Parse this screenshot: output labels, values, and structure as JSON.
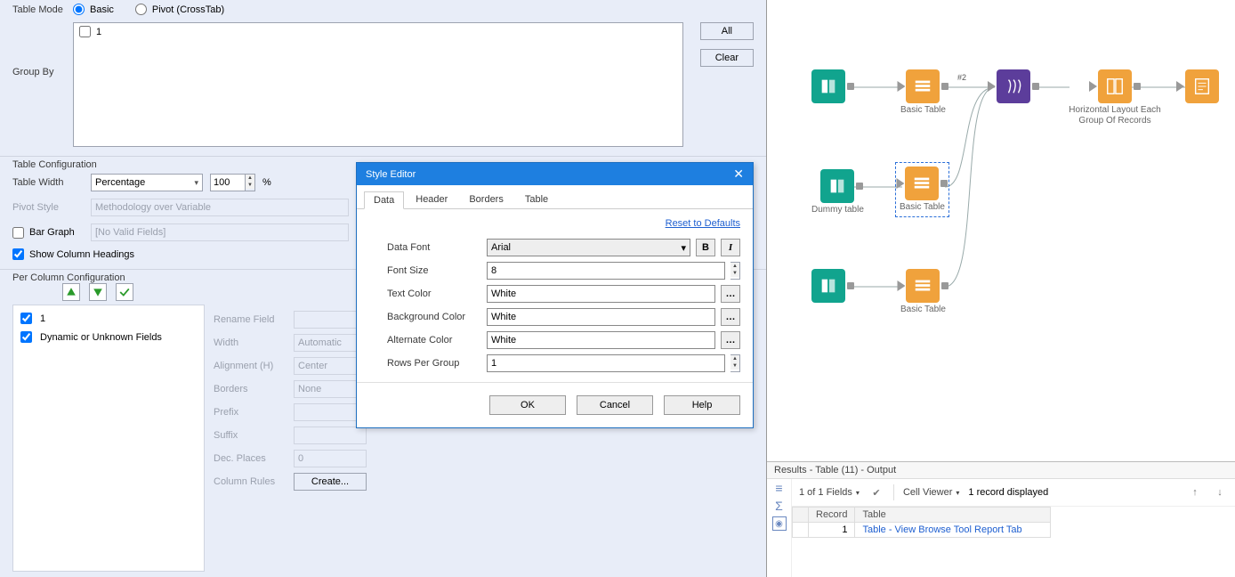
{
  "config": {
    "tableMode": {
      "label": "Table Mode",
      "basic": "Basic",
      "pivot": "Pivot (CrossTab)",
      "selected": "basic"
    },
    "groupBy": {
      "label": "Group By",
      "items": [
        "1"
      ],
      "allBtn": "All",
      "clearBtn": "Clear"
    },
    "tableConfig": {
      "title": "Table Configuration",
      "tableWidth": {
        "label": "Table Width",
        "unit": "Percentage",
        "value": "100",
        "suffix": "%"
      },
      "pivotStyle": {
        "label": "Pivot Style",
        "value": "Methodology over Variable"
      },
      "barGraph": {
        "label": "Bar Graph",
        "value": "[No Valid Fields]",
        "checked": false
      },
      "showHeadings": {
        "label": "Show Column Headings",
        "checked": true
      }
    },
    "perColumn": {
      "title": "Per Column Configuration",
      "fields": [
        {
          "name": "1",
          "checked": true
        },
        {
          "name": "Dynamic or Unknown Fields",
          "checked": true
        }
      ],
      "props": {
        "renameField": {
          "label": "Rename Field",
          "value": ""
        },
        "width": {
          "label": "Width",
          "value": "Automatic"
        },
        "alignment": {
          "label": "Alignment (H)",
          "value": "Center"
        },
        "borders": {
          "label": "Borders",
          "value": "None"
        },
        "prefix": {
          "label": "Prefix",
          "value": ""
        },
        "suffix": {
          "label": "Suffix",
          "value": ""
        },
        "decPlaces": {
          "label": "Dec. Places",
          "value": "0"
        },
        "columnRules": {
          "label": "Column Rules",
          "btn": "Create..."
        }
      }
    }
  },
  "dialog": {
    "title": "Style Editor",
    "tabs": [
      "Data",
      "Header",
      "Borders",
      "Table"
    ],
    "activeTab": 0,
    "resetLink": "Reset to Defaults",
    "fields": {
      "dataFont": {
        "label": "Data Font",
        "value": "Arial"
      },
      "fontSize": {
        "label": "Font Size",
        "value": "8"
      },
      "textColor": {
        "label": "Text Color",
        "value": "White"
      },
      "bgColor": {
        "label": "Background Color",
        "value": "White"
      },
      "altColor": {
        "label": "Alternate Color",
        "value": "White"
      },
      "rowsPerGroup": {
        "label": "Rows Per Group",
        "value": "1"
      }
    },
    "buttons": {
      "ok": "OK",
      "cancel": "Cancel",
      "help": "Help"
    }
  },
  "canvas": {
    "nodes": {
      "n1": {
        "caption": ""
      },
      "n2": {
        "caption": "Basic Table"
      },
      "n3": {
        "caption": ""
      },
      "n4": {
        "caption": "Horizontal Layout Each Group Of Records"
      },
      "n5": {
        "caption": ""
      },
      "n6": {
        "caption": "Dummy table"
      },
      "n7": {
        "caption": "Basic Table"
      },
      "n8": {
        "caption": ""
      },
      "n9": {
        "caption": "Basic Table"
      },
      "anchorLabel": "#2"
    }
  },
  "results": {
    "title": "Results - Table (11) - Output",
    "fieldsInfo": "1 of 1 Fields",
    "cellViewer": "Cell Viewer",
    "recordInfo": "1 record displayed",
    "columns": [
      "Record",
      "Table"
    ],
    "rows": [
      {
        "record": "1",
        "table": "Table - View Browse Tool Report Tab"
      }
    ]
  }
}
